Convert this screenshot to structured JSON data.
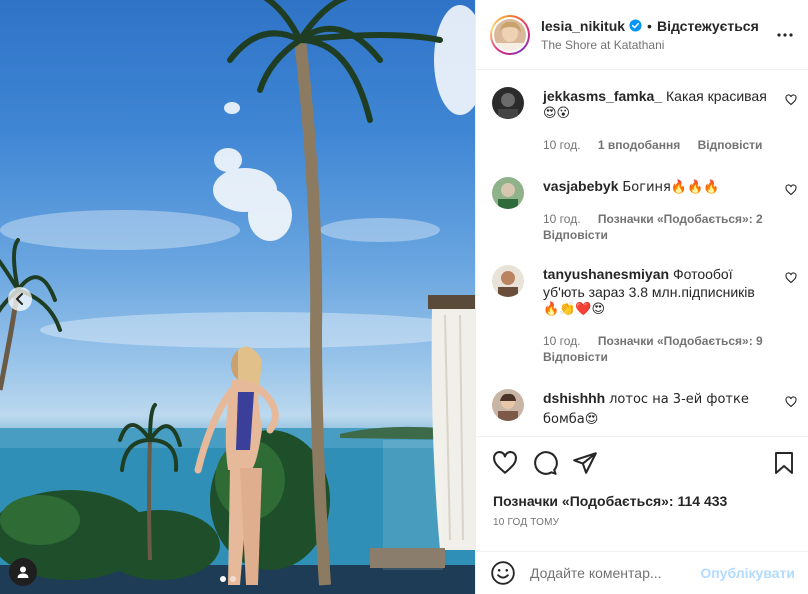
{
  "post": {
    "username": "lesia_nikituk",
    "separator": "•",
    "follow_label": "Відстежується",
    "location": "The Shore at Katathani"
  },
  "comments": [
    {
      "username": "jekkasms_famka_",
      "text": "Какая красивая",
      "emoji": "😍😮",
      "time": "10 год.",
      "likes": "1 вподобання",
      "reply": "Відповісти"
    },
    {
      "username": "vasjabebyk",
      "text": "Богиня🔥🔥🔥",
      "emoji": "",
      "time": "10 год.",
      "likes": "Позначки «Подобається»: 2",
      "reply": "Відповісти"
    },
    {
      "username": "tanyushanesmiyan",
      "text": "Фотообої уб'ють зараз 3.8 млн.підписників",
      "emoji": "🔥👏❤️😍",
      "time": "10 год.",
      "likes": "Позначки «Подобається»: 9",
      "reply": "Відповісти"
    },
    {
      "username": "dshishhh",
      "text": "лотос на 3-ей фотке бомба😍",
      "emoji": "",
      "time": "",
      "likes": "",
      "reply": ""
    }
  ],
  "stats": {
    "likes_label": "Позначки «Подобається»: 114 433",
    "timestamp": "10 ГОД ТОМУ"
  },
  "composer": {
    "placeholder": "Додайте коментар...",
    "publish_label": "Опублікувати"
  },
  "carousel": {
    "slide_count": 2,
    "active_index": 1
  },
  "colors": {
    "verified": "#0095f6",
    "publish_disabled": "#b3dbff",
    "text_primary": "#262626",
    "text_secondary": "#737373"
  },
  "icons": {
    "prev": "chevron-left-icon",
    "tag": "user-tag-icon",
    "more": "more-horizontal-icon",
    "like": "heart-icon",
    "comment": "comment-icon",
    "share": "paper-plane-icon",
    "save": "bookmark-icon",
    "emoji": "emoji-icon"
  }
}
